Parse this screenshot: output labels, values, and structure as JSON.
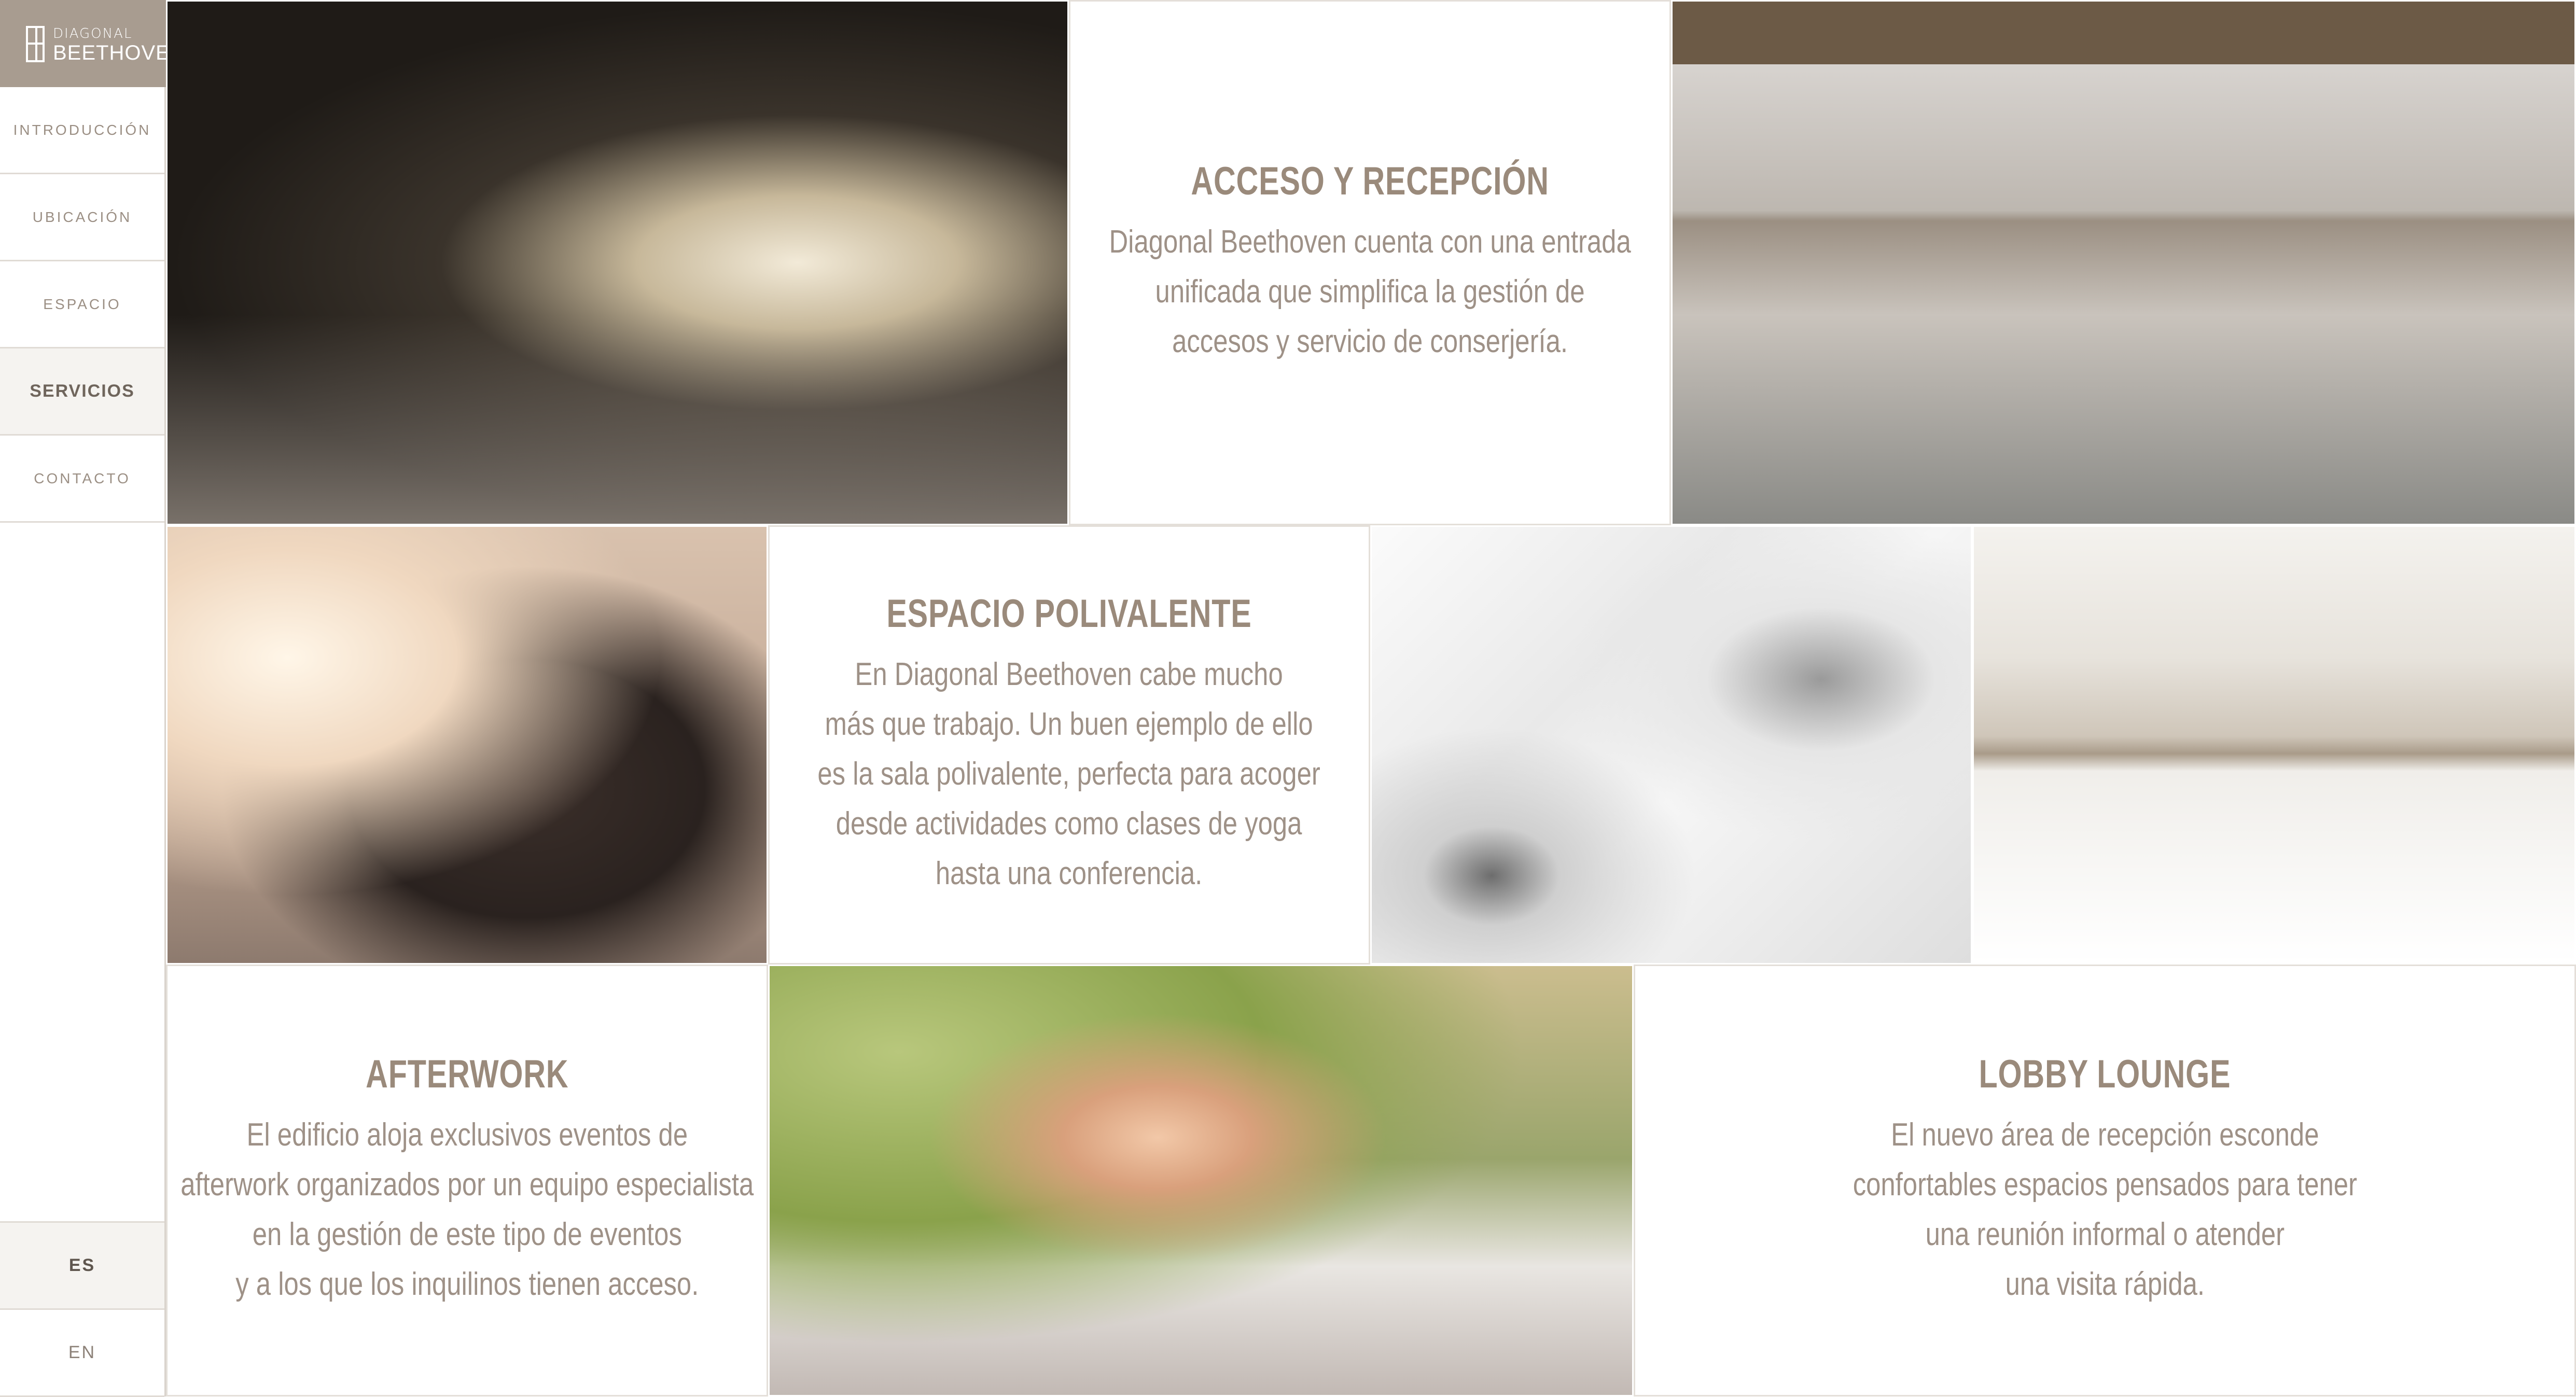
{
  "brand": {
    "small": "DIAGONAL",
    "big": "BEETHOVEN"
  },
  "nav": [
    {
      "label": "INTRODUCCIÓN",
      "active": false
    },
    {
      "label": "UBICACIÓN",
      "active": false
    },
    {
      "label": "ESPACIO",
      "active": false
    },
    {
      "label": "SERVICIOS",
      "active": true
    },
    {
      "label": "CONTACTO",
      "active": false
    }
  ],
  "languages": [
    {
      "label": "ES",
      "active": true
    },
    {
      "label": "EN",
      "active": false
    }
  ],
  "sections": {
    "acceso": {
      "title": "ACCESO Y RECEPCIÓN",
      "lines": [
        "Diagonal Beethoven cuenta con una entrada",
        "unificada que simplifica la gestión de",
        "accesos y servicio de conserjería."
      ]
    },
    "polivalente": {
      "title": "ESPACIO POLIVALENTE",
      "lines": [
        "En Diagonal Beethoven cabe mucho",
        "más que trabajo. Un buen ejemplo de ello",
        "es la sala polivalente, perfecta para acoger",
        "desde actividades como clases de yoga",
        "hasta una conferencia."
      ]
    },
    "afterwork": {
      "title": "AFTERWORK",
      "lines": [
        "El edificio aloja exclusivos eventos de",
        "afterwork organizados por un equipo especialista",
        "en la gestión de este tipo de eventos",
        "y a los que los inquilinos tienen acceso."
      ]
    },
    "lobby": {
      "title": "LOBBY LOUNGE",
      "lines": [
        "El nuevo área de recepción esconde",
        "confortables espacios pensados para tener",
        "una reunión informal o atender",
        "una visita rápida."
      ]
    }
  }
}
